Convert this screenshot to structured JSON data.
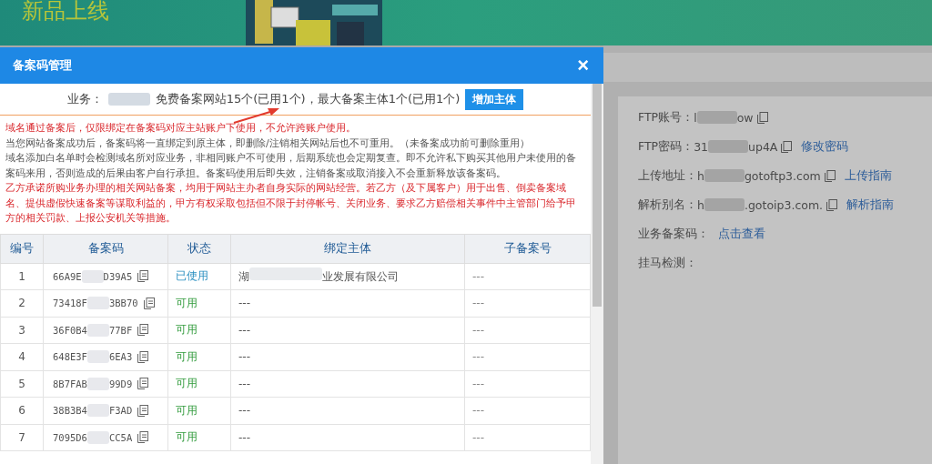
{
  "banner": {
    "title": "新品上线"
  },
  "modal": {
    "title": "备案码管理",
    "close": "×",
    "summary": {
      "label": "业务：",
      "text": "免费备案网站15个(已用1个)，最大备案主体1个(已用1个)",
      "button": "增加主体"
    },
    "notices": [
      {
        "kind": "warning",
        "text": "域名通过备案后，仅限绑定在备案码对应主站账户下使用，不允许跨账户使用。"
      },
      {
        "kind": "normal",
        "text": "当您网站备案成功后，备案码将一直绑定到原主体，即删除/注销相关网站后也不可重用。（未备案成功前可删除重用）"
      },
      {
        "kind": "normal",
        "text": "域名添加白名单时会检测域名所对应业务，非相同账户不可使用，后期系统也会定期复查。即不允许私下购买其他用户未使用的备案码来用，否则造成的后果由客户自行承担。备案码使用后即失效，注销备案或取消接入不会重新释放该备案码。"
      },
      {
        "kind": "warning",
        "text": "乙方承诺所购业务办理的相关网站备案，均用于网站主办者自身实际的网站经营。若乙方（及下属客户）用于出售、倒卖备案域名、提供虚假快速备案等谋取利益的，甲方有权采取包括但不限于封停帐号、关闭业务、要求乙方赔偿相关事件中主管部门给予甲方的相关罚款、上报公安机关等措施。"
      }
    ],
    "table": {
      "columns": [
        "编号",
        "备案码",
        "状态",
        "绑定主体",
        "子备案号"
      ],
      "rows": [
        {
          "no": "1",
          "code_start": "66A9E",
          "code_end": "D39A5",
          "status": "已使用",
          "used": true,
          "owner_start": "湖",
          "owner_end": "业发展有限公司",
          "sub": "---"
        },
        {
          "no": "2",
          "code_start": "73418F",
          "code_end": "3BB70",
          "status": "可用",
          "used": false,
          "owner_start": "---",
          "sub": "---"
        },
        {
          "no": "3",
          "code_start": "36F0B4",
          "code_end": "77BF",
          "status": "可用",
          "used": false,
          "owner_start": "---",
          "sub": "---"
        },
        {
          "no": "4",
          "code_start": "648E3F",
          "code_end": "6EA3",
          "status": "可用",
          "used": false,
          "owner_start": "---",
          "sub": "---"
        },
        {
          "no": "5",
          "code_start": "8B7FAB",
          "code_end": "99D9",
          "status": "可用",
          "used": false,
          "owner_start": "---",
          "sub": "---"
        },
        {
          "no": "6",
          "code_start": "38B3B4",
          "code_end": "F3AD",
          "status": "可用",
          "used": false,
          "owner_start": "---",
          "sub": "---"
        },
        {
          "no": "7",
          "code_start": "7095D6",
          "code_end": "CC5A",
          "status": "可用",
          "used": false,
          "owner_start": "---",
          "sub": "---"
        }
      ]
    }
  },
  "info": [
    {
      "label": "FTP账号：",
      "value_start": "l",
      "value_end": "ow"
    },
    {
      "label": "FTP密码：",
      "value_start": "31",
      "value_end": "up4A",
      "link": "修改密码"
    },
    {
      "label": "上传地址：",
      "value_start": "h",
      "value_end": "gotoftp3.com",
      "link": "上传指南"
    },
    {
      "label": "解析别名：",
      "value_start": "h",
      "value_end": ".gotoip3.com.",
      "link": "解析指南"
    },
    {
      "label": "业务备案码：",
      "link": "点击查看"
    },
    {
      "label": "挂马检测："
    }
  ]
}
